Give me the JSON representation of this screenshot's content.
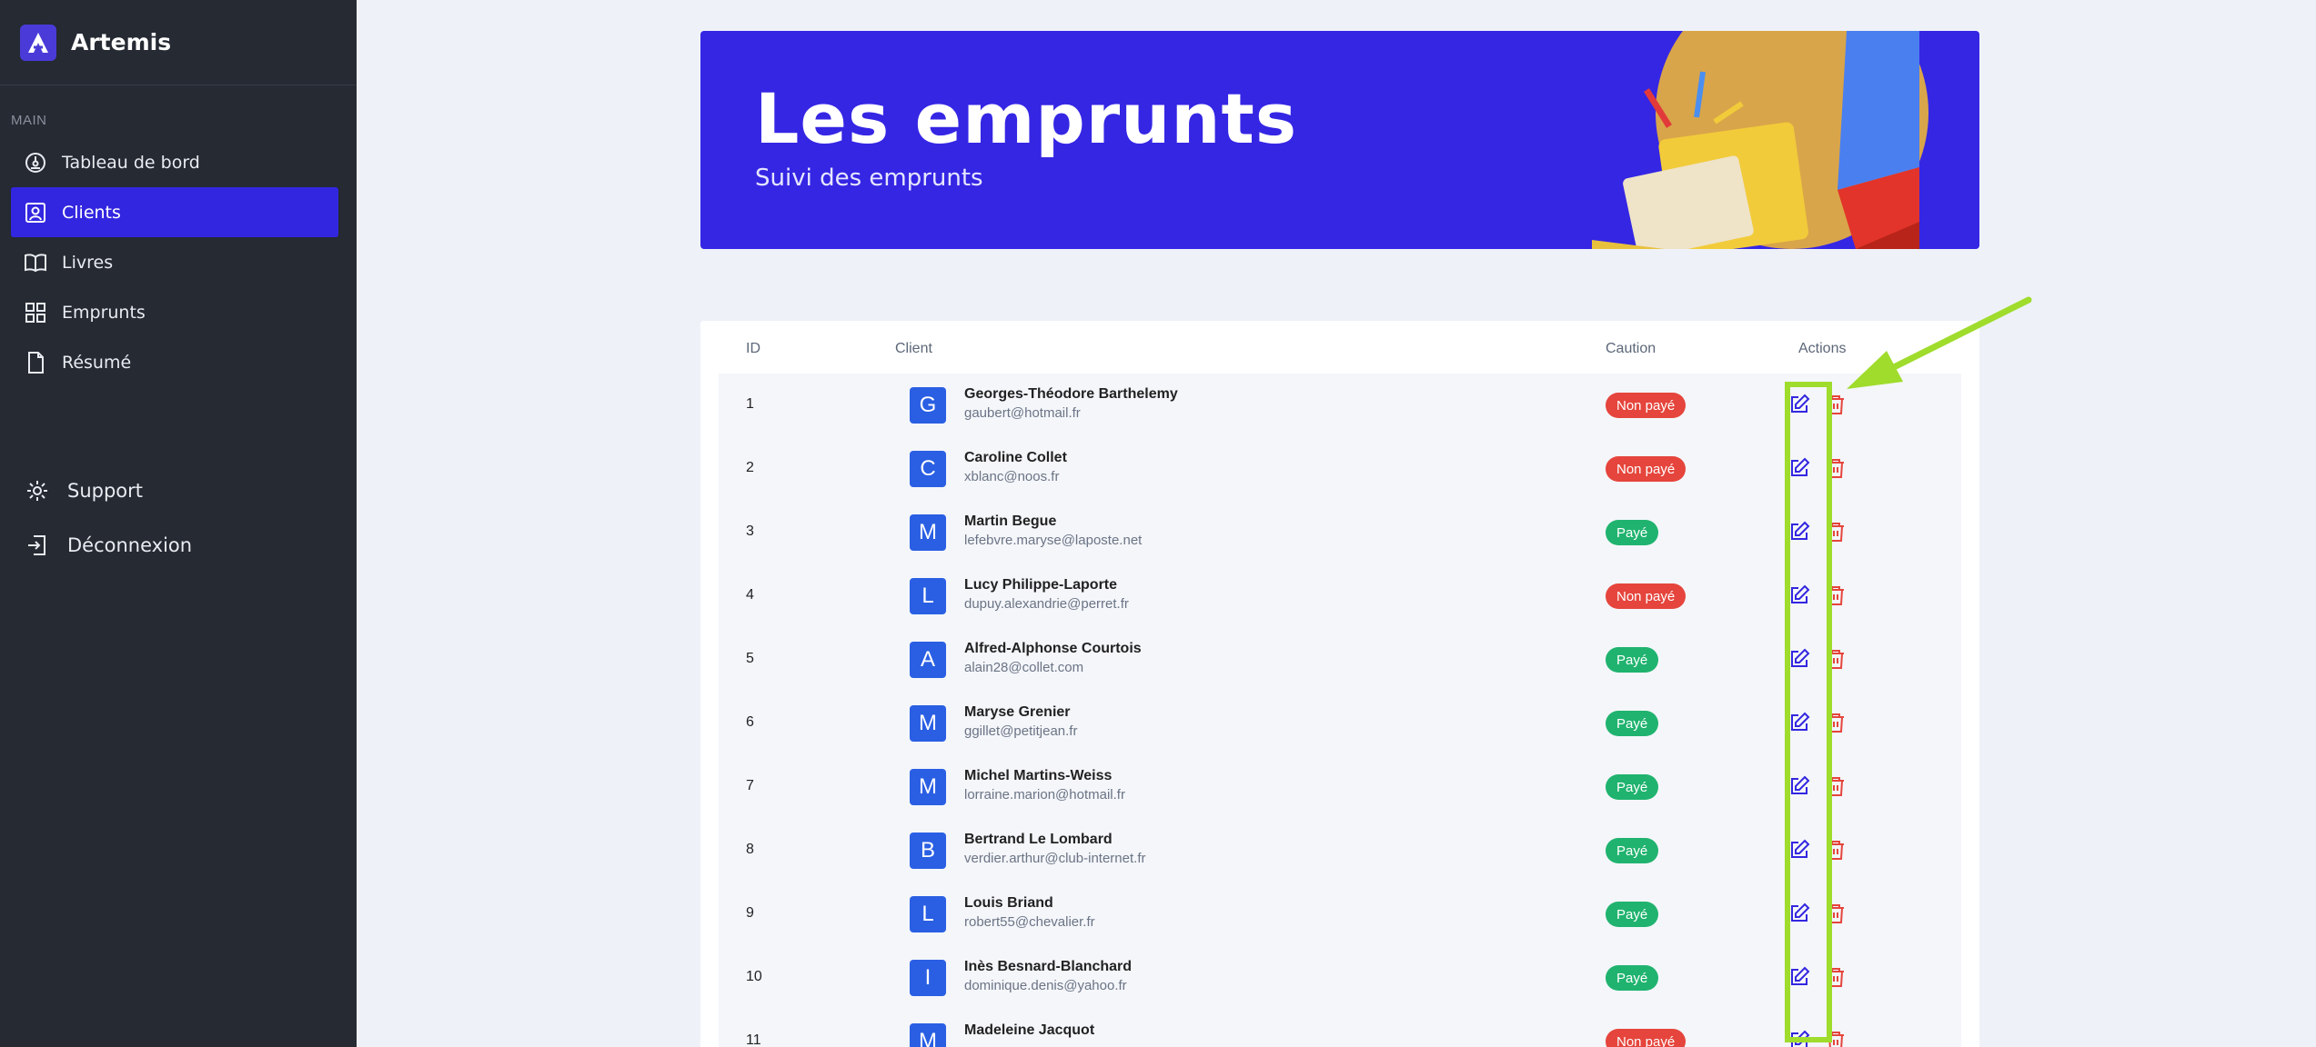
{
  "brand": {
    "name": "Artemis"
  },
  "sidebar": {
    "section_label": "MAIN",
    "items": [
      {
        "label": "Tableau de bord",
        "icon": "dashboard-icon",
        "active": false
      },
      {
        "label": "Clients",
        "icon": "user-icon",
        "active": true
      },
      {
        "label": "Livres",
        "icon": "book-icon",
        "active": false
      },
      {
        "label": "Emprunts",
        "icon": "grid-icon",
        "active": false
      },
      {
        "label": "Résumé",
        "icon": "document-icon",
        "active": false
      }
    ],
    "bottom": [
      {
        "label": "Support",
        "icon": "gear-icon"
      },
      {
        "label": "Déconnexion",
        "icon": "logout-icon"
      }
    ]
  },
  "hero": {
    "title": "Les emprunts",
    "subtitle": "Suivi des emprunts"
  },
  "table": {
    "headers": {
      "id": "ID",
      "client": "Client",
      "caution": "Caution",
      "actions": "Actions"
    },
    "rows": [
      {
        "id": "1",
        "initial": "G",
        "name": "Georges-Théodore Barthelemy",
        "email": "gaubert@hotmail.fr",
        "caution": "Non payé",
        "paid": false
      },
      {
        "id": "2",
        "initial": "C",
        "name": "Caroline Collet",
        "email": "xblanc@noos.fr",
        "caution": "Non payé",
        "paid": false
      },
      {
        "id": "3",
        "initial": "M",
        "name": "Martin Begue",
        "email": "lefebvre.maryse@laposte.net",
        "caution": "Payé",
        "paid": true
      },
      {
        "id": "4",
        "initial": "L",
        "name": "Lucy Philippe-Laporte",
        "email": "dupuy.alexandrie@perret.fr",
        "caution": "Non payé",
        "paid": false
      },
      {
        "id": "5",
        "initial": "A",
        "name": "Alfred-Alphonse Courtois",
        "email": "alain28@collet.com",
        "caution": "Payé",
        "paid": true
      },
      {
        "id": "6",
        "initial": "M",
        "name": "Maryse Grenier",
        "email": "ggillet@petitjean.fr",
        "caution": "Payé",
        "paid": true
      },
      {
        "id": "7",
        "initial": "M",
        "name": "Michel Martins-Weiss",
        "email": "lorraine.marion@hotmail.fr",
        "caution": "Payé",
        "paid": true
      },
      {
        "id": "8",
        "initial": "B",
        "name": "Bertrand Le Lombard",
        "email": "verdier.arthur@club-internet.fr",
        "caution": "Payé",
        "paid": true
      },
      {
        "id": "9",
        "initial": "L",
        "name": "Louis Briand",
        "email": "robert55@chevalier.fr",
        "caution": "Payé",
        "paid": true
      },
      {
        "id": "10",
        "initial": "I",
        "name": "Inès Besnard-Blanchard",
        "email": "dominique.denis@yahoo.fr",
        "caution": "Payé",
        "paid": true
      },
      {
        "id": "11",
        "initial": "M",
        "name": "Madeleine Jacquot",
        "email": "",
        "caution": "Non payé",
        "paid": false
      }
    ]
  },
  "colors": {
    "sidebar_bg": "#252a33",
    "accent": "#3326e0",
    "unpaid": "#e5453c",
    "paid": "#20b36f",
    "avatar": "#2a5fe3",
    "annotation": "#9fdc2c"
  }
}
